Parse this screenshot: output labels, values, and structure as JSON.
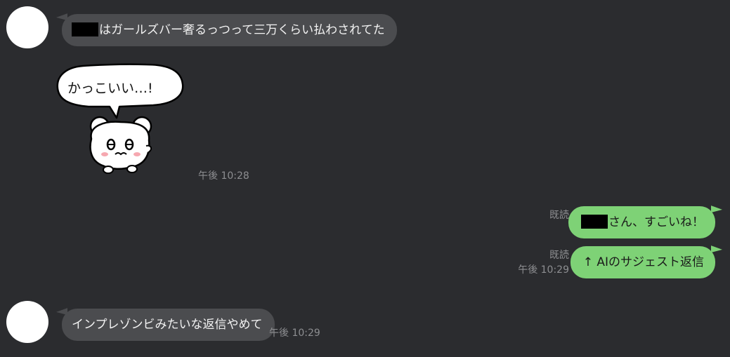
{
  "messages": [
    {
      "direction": "in",
      "text": "はガールズバー奢るっつって三万くらい払わされてた"
    },
    {
      "direction": "in",
      "type": "sticker",
      "sticker_text": "かっこいい…!",
      "time": "午後 10:28"
    },
    {
      "direction": "out",
      "text": "さん、すごいね！",
      "read": "既読"
    },
    {
      "direction": "out",
      "text": "↑ AIのサジェスト返信",
      "read": "既読",
      "time": "午後 10:29"
    },
    {
      "direction": "in",
      "text": "インプレゾンビみたいな返信やめて",
      "time": "午後 10:29"
    }
  ],
  "colors": {
    "background": "#2b2c2f",
    "incoming_bubble": "#4b4c4f",
    "outgoing_bubble": "#7ed276",
    "meta_text": "#8d8e91"
  }
}
